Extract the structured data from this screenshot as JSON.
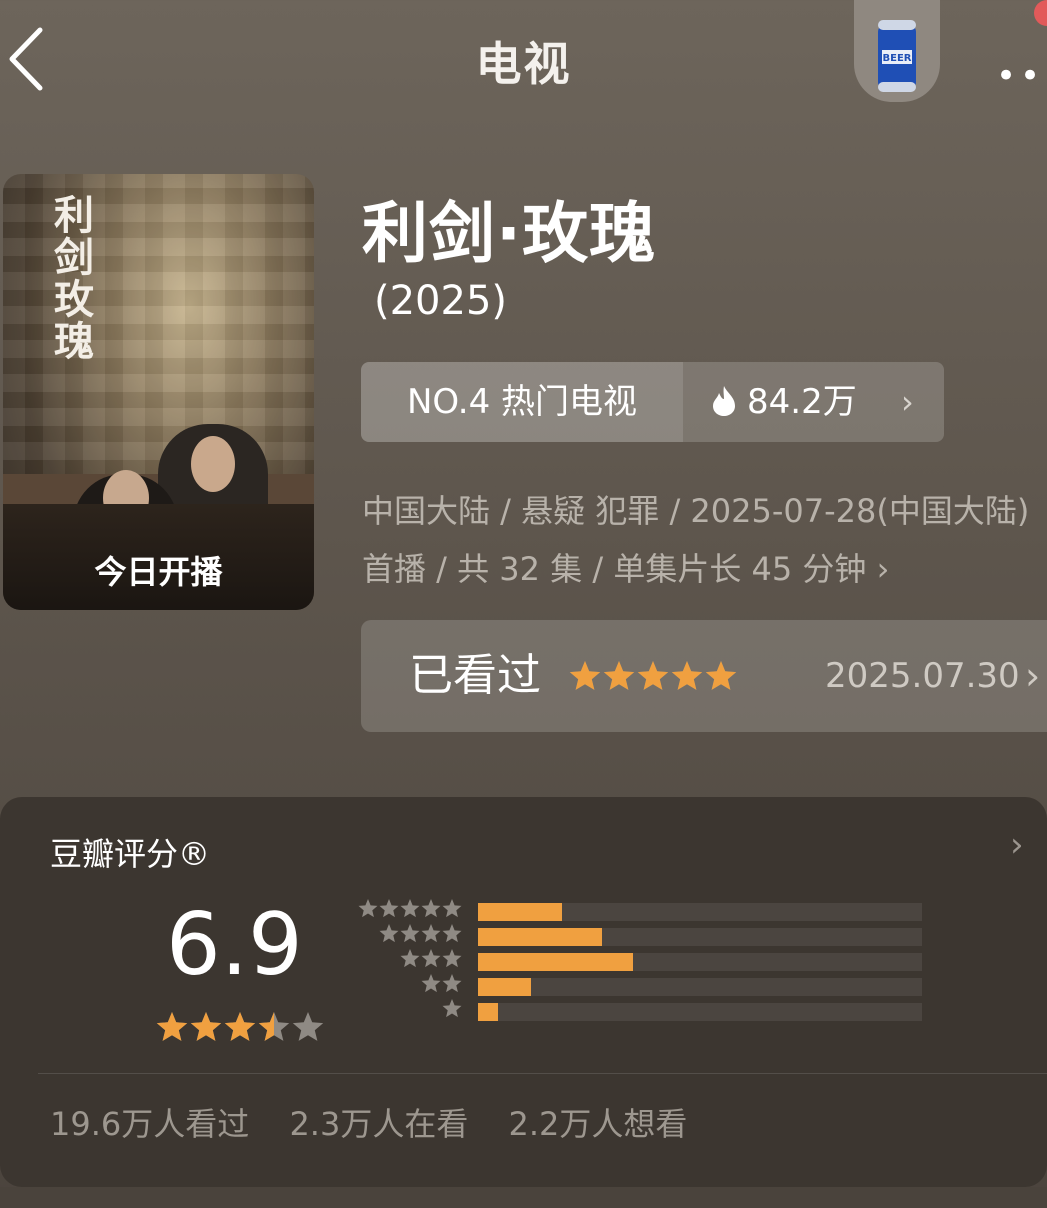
{
  "header": {
    "title": "电视",
    "more_label": "•••",
    "beer_text": "BEER"
  },
  "poster": {
    "title": "利剑玫瑰",
    "badge": "今日开播"
  },
  "show": {
    "name": "利剑·玫瑰",
    "year": "(2025)",
    "rank_label": "NO.4 热门电视",
    "heat": "84.2万",
    "meta": "中国大陆 / 悬疑 犯罪 / 2025-07-28(中国大陆) 首播 / 共 32 集 / 单集片长 45 分钟"
  },
  "watched": {
    "label": "已看过",
    "date": "2025.07.30",
    "user_stars": 5
  },
  "rating": {
    "title": "豆瓣评分®",
    "score": "6.9",
    "stars": 3.5,
    "distribution": [
      {
        "stars": 5,
        "fraction": 0.19
      },
      {
        "stars": 4,
        "fraction": 0.28
      },
      {
        "stars": 3,
        "fraction": 0.35
      },
      {
        "stars": 2,
        "fraction": 0.12
      },
      {
        "stars": 1,
        "fraction": 0.045
      }
    ],
    "counts": [
      "19.6万人看过",
      "2.3万人在看",
      "2.2万人想看"
    ]
  },
  "colors": {
    "accent_star": "#f0a040",
    "muted_star": "#8f8a84"
  }
}
